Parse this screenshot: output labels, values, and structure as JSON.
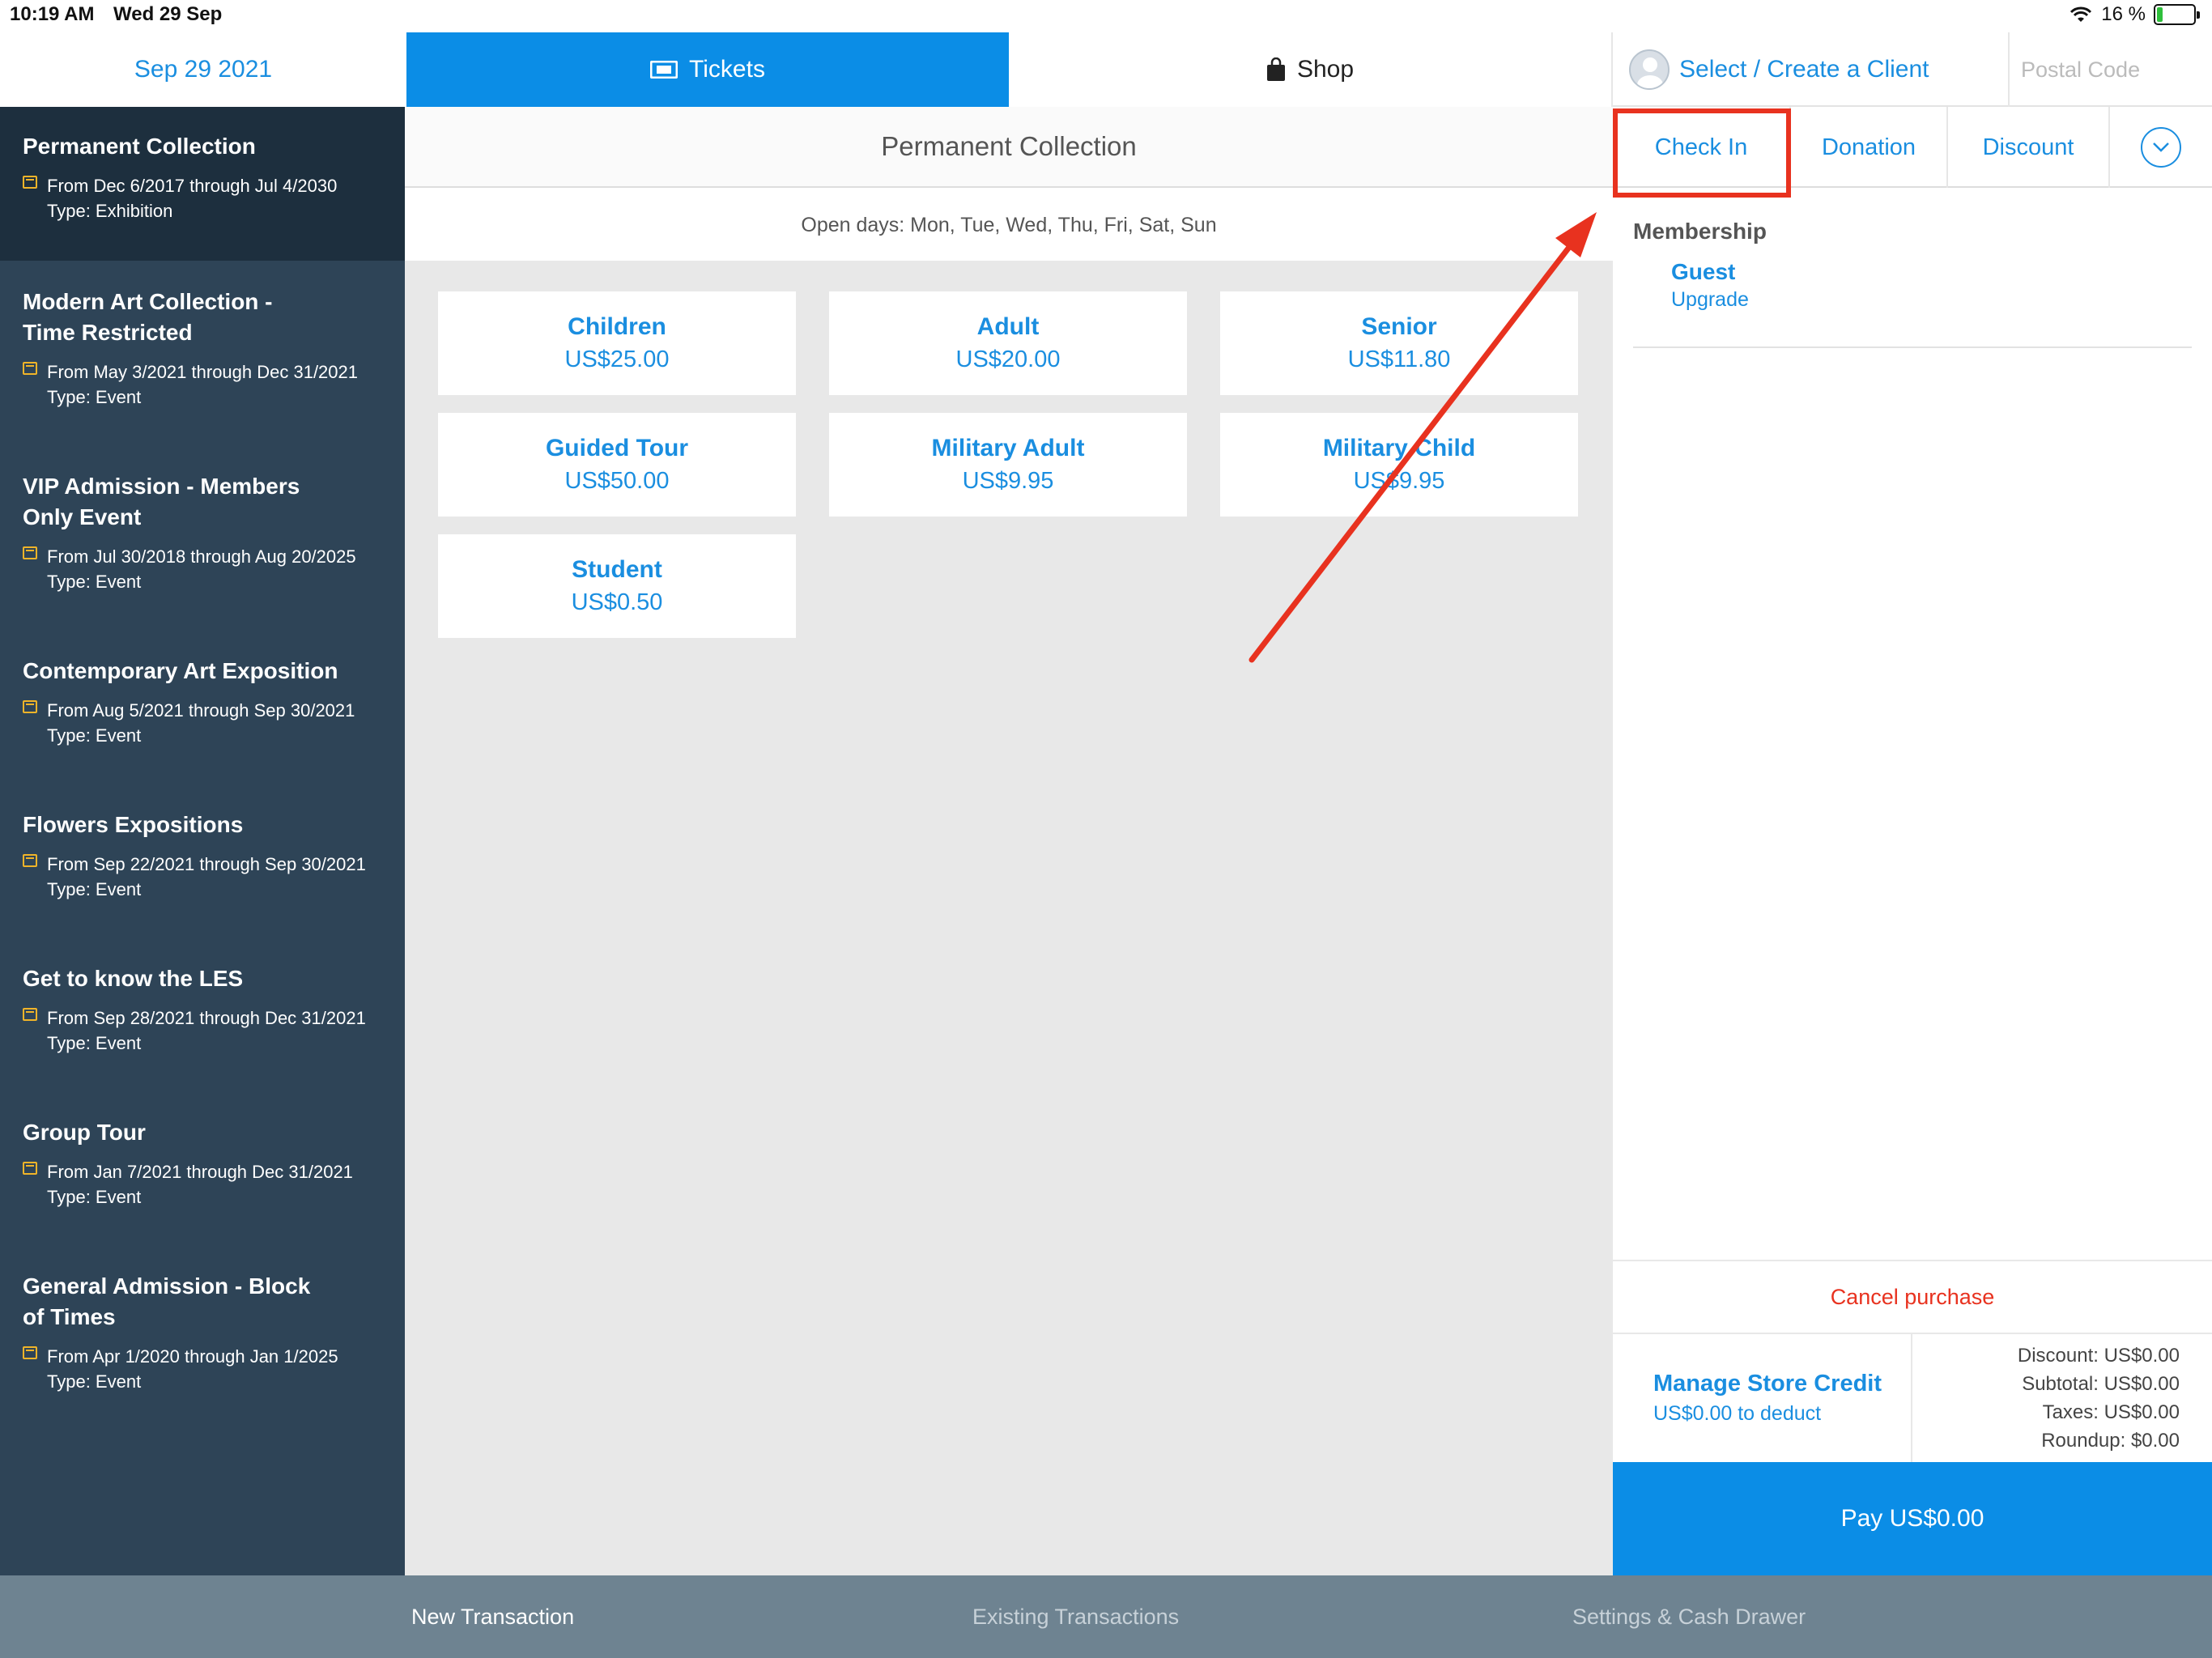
{
  "status_bar": {
    "time": "10:19 AM",
    "date": "Wed 29 Sep",
    "battery": "16 %",
    "battery_level": 0.16
  },
  "top_nav": {
    "date_tab": "Sep 29 2021",
    "tickets_tab": "Tickets",
    "shop_tab": "Shop",
    "client_label": "Select / Create a Client",
    "postal_placeholder": "Postal Code"
  },
  "sidebar": {
    "events": [
      {
        "title": "Permanent Collection",
        "dates": "From Dec 6/2017 through Jul 4/2030",
        "type": "Type: Exhibition"
      },
      {
        "title": "Modern Art Collection - Time Restricted",
        "dates": "From May 3/2021 through Dec 31/2021",
        "type": "Type: Event"
      },
      {
        "title": "VIP Admission - Members Only Event",
        "dates": "From Jul 30/2018 through Aug 20/2025",
        "type": "Type: Event"
      },
      {
        "title": "Contemporary Art Exposition",
        "dates": "From Aug 5/2021 through Sep 30/2021",
        "type": "Type: Event"
      },
      {
        "title": "Flowers Expositions",
        "dates": "From Sep 22/2021 through Sep 30/2021",
        "type": "Type: Event"
      },
      {
        "title": "Get to know the LES",
        "dates": "From Sep 28/2021 through Dec 31/2021",
        "type": "Type: Event"
      },
      {
        "title": "Group Tour",
        "dates": "From Jan 7/2021 through Dec 31/2021",
        "type": "Type: Event"
      },
      {
        "title": "General Admission - Block of Times",
        "dates": "From Apr 1/2020 through Jan 1/2025",
        "type": "Type: Event"
      }
    ]
  },
  "main": {
    "title": "Permanent Collection",
    "open_days": "Open days: Mon, Tue, Wed, Thu, Fri, Sat, Sun",
    "tickets": [
      {
        "name": "Children",
        "price": "US$25.00"
      },
      {
        "name": "Adult",
        "price": "US$20.00"
      },
      {
        "name": "Senior",
        "price": "US$11.80"
      },
      {
        "name": "Guided Tour",
        "price": "US$50.00"
      },
      {
        "name": "Military Adult",
        "price": "US$9.95"
      },
      {
        "name": "Military Child",
        "price": "US$9.95"
      },
      {
        "name": "Student",
        "price": "US$0.50"
      }
    ]
  },
  "right_panel": {
    "actions": {
      "check_in": "Check In",
      "donation": "Donation",
      "discount": "Discount"
    },
    "membership": {
      "label": "Membership",
      "level": "Guest",
      "upgrade": "Upgrade"
    },
    "cancel": "Cancel purchase",
    "store_credit": {
      "title": "Manage Store Credit",
      "subtitle": "US$0.00 to deduct"
    },
    "totals": {
      "discount": "Discount: US$0.00",
      "subtotal": "Subtotal: US$0.00",
      "taxes": "Taxes: US$0.00",
      "roundup": "Roundup: $0.00"
    },
    "pay": "Pay US$0.00"
  },
  "bottom_bar": {
    "new_transaction": "New Transaction",
    "existing_transactions": "Existing Transactions",
    "settings": "Settings & Cash Drawer"
  },
  "colors": {
    "accent": "#0b8de6",
    "sidebar": "#2e4457",
    "annotation": "#e8321f"
  }
}
